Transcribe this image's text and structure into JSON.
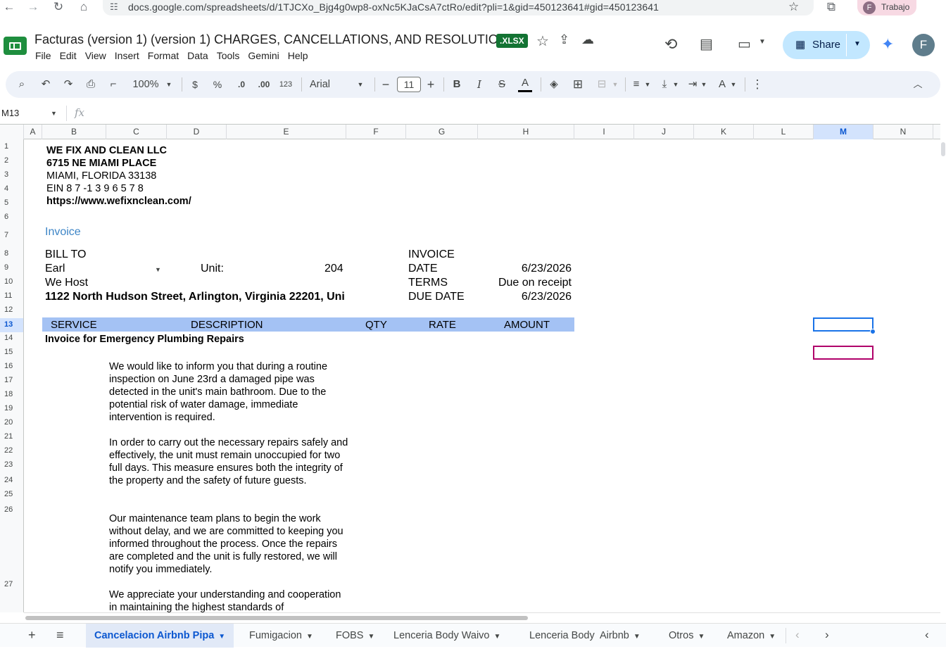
{
  "browser": {
    "url": "docs.google.com/spreadsheets/d/1TJCXo_Bjg4g0wp8-oxNc5KJaCsA7ctRo/edit?pli=1&gid=450123641#gid=450123641",
    "profile_initial": "F",
    "profile_label": "Trabajo"
  },
  "doc": {
    "title": "Facturas (version 1) (version 1) CHARGES, CANCELLATIONS, AND RESOLUTIONS",
    "format_badge": ".XLSX",
    "share_label": "Share",
    "account_initial": "F"
  },
  "menu": [
    "File",
    "Edit",
    "View",
    "Insert",
    "Format",
    "Data",
    "Tools",
    "Gemini",
    "Help"
  ],
  "toolbar": {
    "zoom": "100%",
    "currency": "$",
    "percent": "%",
    "dec_decrease": ".0",
    "dec_increase": ".00",
    "number_format": "123",
    "font": "Arial",
    "font_size": "11"
  },
  "formula_bar": {
    "name_box": "M13",
    "fx_label": "fx",
    "value": ""
  },
  "columns": [
    "A",
    "B",
    "C",
    "D",
    "E",
    "F",
    "G",
    "H",
    "I",
    "J",
    "K",
    "L",
    "M",
    "N"
  ],
  "selected_column": "M",
  "rows": [
    "1",
    "2",
    "3",
    "4",
    "5",
    "6",
    "7",
    "8",
    "9",
    "10",
    "11",
    "12",
    "13",
    "14",
    "15",
    "16",
    "17",
    "18",
    "19",
    "20",
    "21",
    "22",
    "23",
    "24",
    "25",
    "26",
    "27"
  ],
  "selected_row": "13",
  "sheet": {
    "company_name": "WE FIX AND CLEAN LLC",
    "company_street": "6715 NE MIAMI PLACE",
    "company_city": "MIAMI, FLORIDA 33138",
    "company_ein": "EIN 8 7 -1 3 9 6 5 7 8",
    "company_url": "https://www.wefixnclean.com/",
    "invoice_heading": "Invoice",
    "bill_to_label": "BILL TO",
    "bill_to_name": "Earl",
    "unit_label": "Unit:",
    "unit_value": "204",
    "company_billed": "We Host",
    "billing_address": "1122 North Hudson Street, Arlington, Virginia 22201, Uni",
    "invoice_label": "INVOICE",
    "date_label": "DATE",
    "date_value": "6/23/2026",
    "terms_label": "TERMS",
    "terms_value": "Due on receipt",
    "due_date_label": "DUE DATE",
    "due_date_value": "6/23/2026",
    "table_headers": {
      "service": "SERVICE",
      "description": "DESCRIPTION",
      "qty": "QTY",
      "rate": "RATE",
      "amount": "AMOUNT"
    },
    "service_title": "Invoice for Emergency Plumbing Repairs",
    "paragraph_1": "We would like to inform you that during a routine inspection on June 23rd a damaged pipe was detected in the unit's main bathroom. Due to the potential risk of water damage, immediate intervention is required.",
    "paragraph_2": "In order to carry out the necessary repairs safely and effectively, the unit must remain unoccupied for two full days. This measure ensures both the integrity of the property and the safety of future guests.",
    "paragraph_3": "Our maintenance team plans to begin the work without delay, and we are committed to keeping you informed throughout the process. Once the repairs are completed and the unit is fully restored, we will notify you immediately.",
    "paragraph_4": "We appreciate your understanding and cooperation in maintaining the highest standards of"
  },
  "tabs": [
    {
      "label": "Cancelacion Airbnb Pipa",
      "active": true
    },
    {
      "label": "Fumigacion",
      "active": false
    },
    {
      "label": "FOBS",
      "active": false
    },
    {
      "label": "Lenceria Body Waivo",
      "active": false
    },
    {
      "label": "Lenceria Body  Airbnb",
      "active": false
    },
    {
      "label": "Otros",
      "active": false
    },
    {
      "label": "Amazon",
      "active": false
    }
  ],
  "colors": {
    "header_band": "#a4c2f4",
    "selection": "#1a73e8",
    "collaborator_cursor": "#b0006a",
    "invoice_heading": "#3d85c6"
  }
}
